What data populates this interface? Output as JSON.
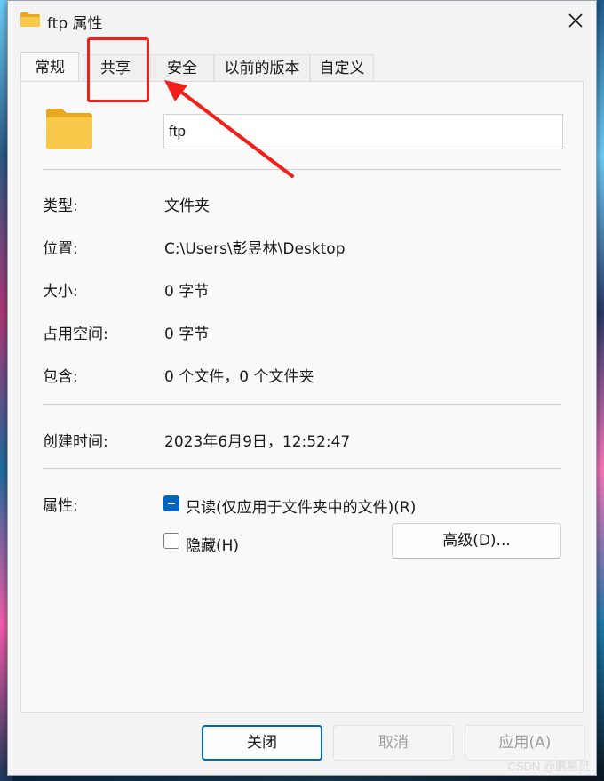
{
  "window": {
    "title": "ftp 属性",
    "title_icon": "folder-icon",
    "close_icon": "close-icon"
  },
  "tabs": [
    {
      "label": "常规",
      "active": true
    },
    {
      "label": "共享",
      "active": false
    },
    {
      "label": "安全",
      "active": false
    },
    {
      "label": "以前的版本",
      "active": false
    },
    {
      "label": "自定义",
      "active": false
    }
  ],
  "general": {
    "name_value": "ftp",
    "rows": [
      {
        "label": "类型:",
        "value": "文件夹"
      },
      {
        "label": "位置:",
        "value": "C:\\Users\\彭昱林\\Desktop"
      },
      {
        "label": "大小:",
        "value": "0 字节"
      },
      {
        "label": "占用空间:",
        "value": "0 字节"
      },
      {
        "label": "包含:",
        "value": "0 个文件，0 个文件夹"
      }
    ],
    "created_label": "创建时间:",
    "created_value": "2023年6月9日，12:52:47",
    "attributes_label": "属性:",
    "readonly_label": "只读(仅应用于文件夹中的文件)(R)",
    "readonly_state": "indeterminate",
    "hidden_label": "隐藏(H)",
    "hidden_state": "unchecked",
    "advanced_label": "高级(D)..."
  },
  "footer": {
    "close_label": "关闭",
    "cancel_label": "取消",
    "apply_label": "应用(A)"
  },
  "annotation": {
    "highlight_color": "#f2201a"
  },
  "watermark": "CSDN @鹏易灵",
  "colors": {
    "accent": "#0067c0",
    "folder": "#f8c94a"
  }
}
